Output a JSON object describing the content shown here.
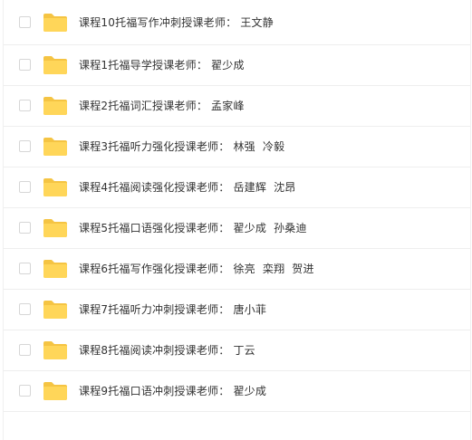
{
  "colors": {
    "folder": "#FFD659",
    "folder_dark": "#F5C443",
    "text": "#333333",
    "divider": "#eeeeee"
  },
  "files": [
    {
      "name": "课程10托福写作冲刺授课老师： 王文静",
      "icon": "folder-icon"
    },
    {
      "name": "课程1托福导学授课老师： 翟少成",
      "icon": "folder-icon"
    },
    {
      "name": "课程2托福词汇授课老师： 孟家峰",
      "icon": "folder-icon"
    },
    {
      "name": "课程3托福听力强化授课老师： 林强  冷毅",
      "icon": "folder-icon"
    },
    {
      "name": "课程4托福阅读强化授课老师： 岳建辉  沈昂",
      "icon": "folder-icon"
    },
    {
      "name": "课程5托福口语强化授课老师： 翟少成  孙桑迪",
      "icon": "folder-icon"
    },
    {
      "name": "课程6托福写作强化授课老师： 徐亮  栾翔  贺进",
      "icon": "folder-icon"
    },
    {
      "name": "课程7托福听力冲刺授课老师： 唐小菲",
      "icon": "folder-icon"
    },
    {
      "name": "课程8托福阅读冲刺授课老师： 丁云",
      "icon": "folder-icon"
    },
    {
      "name": "课程9托福口语冲刺授课老师： 翟少成",
      "icon": "folder-icon"
    }
  ]
}
